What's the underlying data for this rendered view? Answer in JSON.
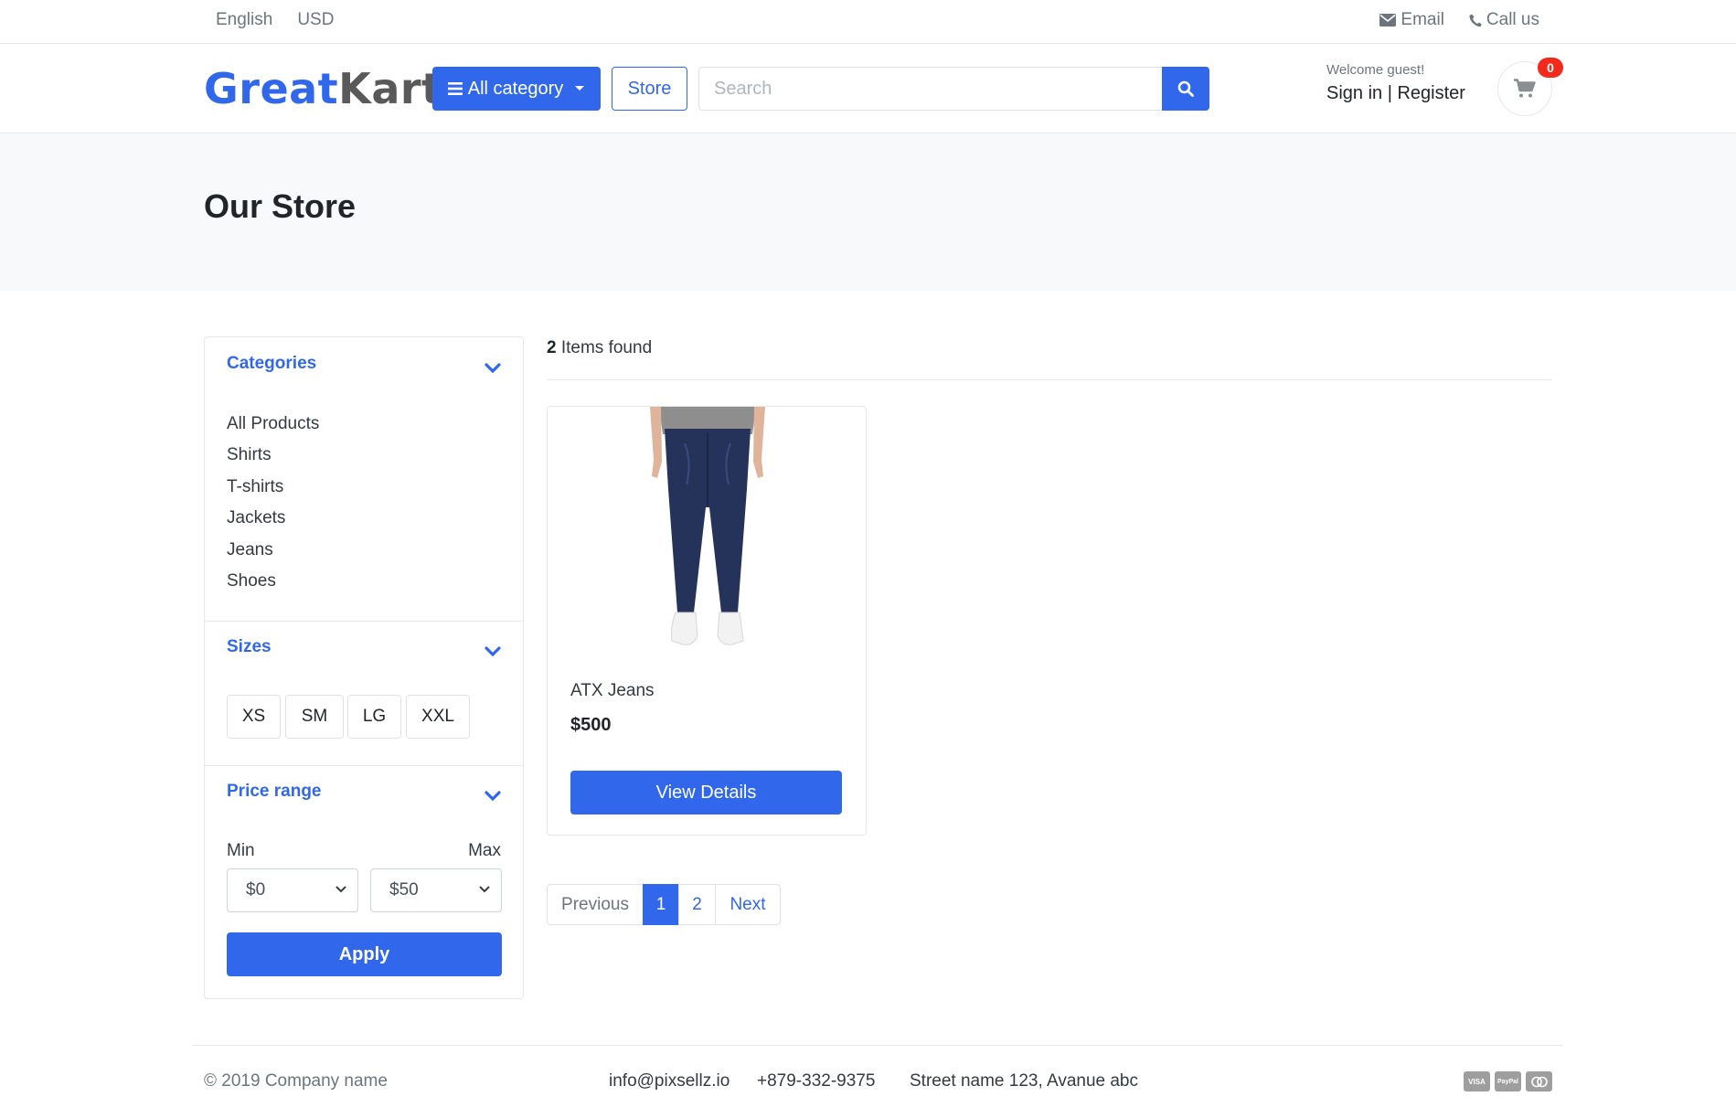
{
  "topbar": {
    "language": "English",
    "currency": "USD",
    "email_label": "Email",
    "call_label": "Call us"
  },
  "header": {
    "logo_part1": "Great",
    "logo_part2": "Kart",
    "all_category_label": "All category",
    "store_label": "Store",
    "search_placeholder": "Search",
    "welcome": "Welcome guest!",
    "sign_in": "Sign in",
    "separator": "|",
    "register": "Register",
    "cart_count": "0"
  },
  "page": {
    "title": "Our Store"
  },
  "sidebar": {
    "categories_title": "Categories",
    "categories": [
      "All Products",
      "Shirts",
      "T-shirts",
      "Jackets",
      "Jeans",
      "Shoes"
    ],
    "sizes_title": "Sizes",
    "sizes": [
      "XS",
      "SM",
      "LG",
      "XXL"
    ],
    "price_title": "Price range",
    "min_label": "Min",
    "max_label": "Max",
    "min_value": "$0",
    "max_value": "$50",
    "apply_label": "Apply"
  },
  "results": {
    "count": "2",
    "count_text": "Items found"
  },
  "products": [
    {
      "name": "ATX Jeans",
      "price": "$500",
      "button": "View Details"
    }
  ],
  "pagination": {
    "previous": "Previous",
    "pages": [
      "1",
      "2"
    ],
    "next": "Next",
    "active_page": "1"
  },
  "footer": {
    "copyright": "© 2019 Company name",
    "email": "info@pixsellz.io",
    "phone": "+879-332-9375",
    "address": "Street name 123, Avanue abc",
    "payment_icons": [
      "visa-icon",
      "paypal-icon",
      "mastercard-icon"
    ],
    "payment_labels": [
      "VISA",
      "PayPal",
      "MC"
    ]
  },
  "colors": {
    "primary": "#3167eb",
    "badge": "#f5291b",
    "band": "#f8f9fa"
  }
}
